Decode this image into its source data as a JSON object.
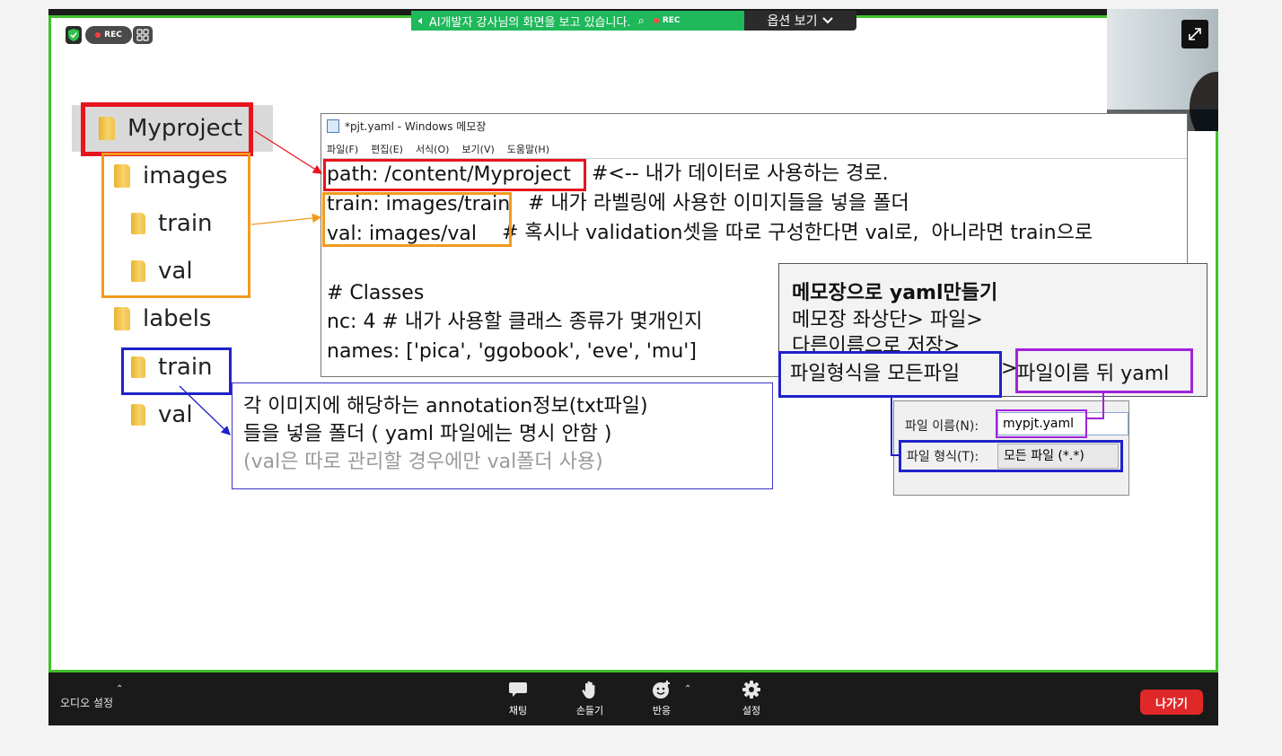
{
  "banner": {
    "share_text": "AI개발자 강사님의 화면을 보고 있습니다.",
    "rec_label": "REC",
    "options_label": "옵션 보기"
  },
  "status": {
    "rec_label": "REC"
  },
  "video": {
    "participant_name": "AI개발자 강사"
  },
  "folder_tree": {
    "root": "Myproject",
    "images": "images",
    "images_train": "train",
    "images_val": "val",
    "labels": "labels",
    "labels_train": "train",
    "labels_val": "val"
  },
  "notepad": {
    "title": "*pjt.yaml - Windows 메모장",
    "menu": [
      "파일(F)",
      "편집(E)",
      "서식(O)",
      "보기(V)",
      "도움말(H)"
    ],
    "lines": {
      "path": "path: /content/Myproject",
      "path_comment": "#<-- 내가 데이터로 사용하는 경로.",
      "train": "train: images/train",
      "train_comment": "# 내가 라벨링에 사용한 이미지들을 넣을 폴더",
      "val": "val: images/val",
      "val_comment": "# 혹시나 validation셋을 따로 구성한다면 val로,  아니라면 train으로",
      "classes": "# Classes",
      "nc": "nc: 4 # 내가 사용할 클래스 종류가 몇개인지",
      "names": "names: ['pica', 'ggobook', 'eve', 'mu']"
    }
  },
  "info_panel": {
    "title": "메모장으로 yaml만들기",
    "line1": "메모장 좌상단> 파일>",
    "line2": "다른이름으로 저장>",
    "line3a": "파일형식을 모든파일",
    "line3b": ">",
    "line3c": "파일이름 뒤 yaml"
  },
  "save_dialog": {
    "filename_label": "파일 이름(N):",
    "filename_value": "mypjt.yaml",
    "filetype_label": "파일 형식(T):",
    "filetype_value": "모든 파일 (*.*)"
  },
  "annotation": {
    "line1": "각 이미지에 해당하는 annotation정보(txt파일)",
    "line2": "들을 넣을 폴더 ( yaml 파일에는 명시 안함 )",
    "line3": "(val은 따로 관리할 경우에만 val폴더 사용)"
  },
  "toolbar": {
    "audio_settings": "오디오 설정",
    "chat": "채팅",
    "raise_hand": "손들기",
    "reactions": "반응",
    "settings": "설정",
    "leave": "나가기"
  },
  "colors": {
    "share_border": "#3fc12b",
    "banner_green": "#1fb85b",
    "red_box": "#e8141c",
    "orange_box": "#f39a1e",
    "blue_box": "#1f22c9",
    "purple_box": "#a024d8",
    "leave_red": "#e02828"
  }
}
